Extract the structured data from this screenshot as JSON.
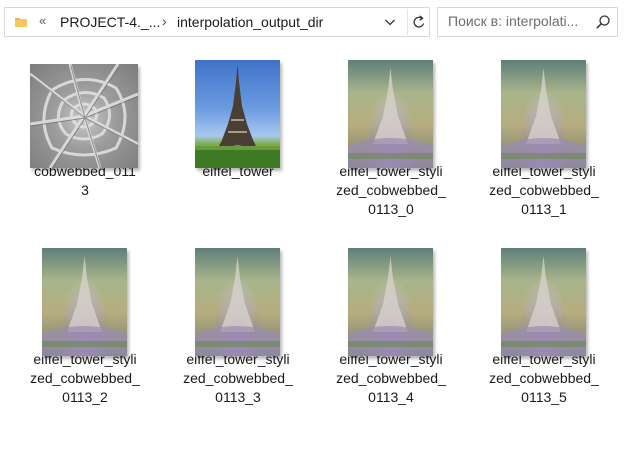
{
  "address_bar": {
    "overflow_chevrons": "«",
    "breadcrumbs": [
      "PROJECT-4._...",
      "interpolation_output_dir"
    ],
    "separator": "›"
  },
  "search": {
    "placeholder": "Поиск в: interpolati..."
  },
  "files": [
    {
      "name": "cobwebbed_0113",
      "line1": "cobwebbed_011",
      "line2": "3",
      "line3": "",
      "thumb": "cobweb-texture"
    },
    {
      "name": "eiffel_tower",
      "line1": "eiffel_tower",
      "line2": "",
      "line3": "",
      "thumb": "eiffel-photo"
    },
    {
      "name": "eiffel_tower_stylized_cobwebbed_0113_0",
      "line1": "eiffel_tower_styli",
      "line2": "zed_cobwebbed_",
      "line3": "0113_0",
      "thumb": "stylized"
    },
    {
      "name": "eiffel_tower_stylized_cobwebbed_0113_1",
      "line1": "eiffel_tower_styli",
      "line2": "zed_cobwebbed_",
      "line3": "0113_1",
      "thumb": "stylized"
    },
    {
      "name": "eiffel_tower_stylized_cobwebbed_0113_2",
      "line1": "eiffel_tower_styli",
      "line2": "zed_cobwebbed_",
      "line3": "0113_2",
      "thumb": "stylized"
    },
    {
      "name": "eiffel_tower_stylized_cobwebbed_0113_3",
      "line1": "eiffel_tower_styli",
      "line2": "zed_cobwebbed_",
      "line3": "0113_3",
      "thumb": "stylized"
    },
    {
      "name": "eiffel_tower_stylized_cobwebbed_0113_4",
      "line1": "eiffel_tower_styli",
      "line2": "zed_cobwebbed_",
      "line3": "0113_4",
      "thumb": "stylized"
    },
    {
      "name": "eiffel_tower_stylized_cobwebbed_0113_5",
      "line1": "eiffel_tower_styli",
      "line2": "zed_cobwebbed_",
      "line3": "0113_5",
      "thumb": "stylized"
    }
  ],
  "colors": {
    "folder": "#e8b64a",
    "border": "#d9d9d9",
    "text": "#1a1a1a",
    "placeholder": "#6d6d6d"
  }
}
